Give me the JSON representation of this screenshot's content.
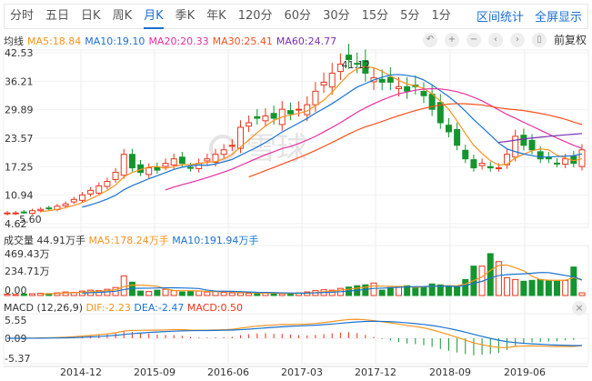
{
  "tabs": [
    "分时",
    "五日",
    "日K",
    "周K",
    "月K",
    "季K",
    "年K",
    "120分",
    "60分",
    "30分",
    "15分",
    "5分",
    "1分"
  ],
  "active_tab": "月K",
  "right_links": [
    "区间统计",
    "全屏显示"
  ],
  "ma": {
    "label": "均线",
    "items": [
      {
        "text": "MA5:18.84",
        "color": "#f7931e"
      },
      {
        "text": "MA10:19.10",
        "color": "#1a73d0"
      },
      {
        "text": "MA20:20.33",
        "color": "#e62ea1"
      },
      {
        "text": "MA30:25.41",
        "color": "#f4511e"
      },
      {
        "text": "MA60:24.77",
        "color": "#7b2fb0"
      }
    ]
  },
  "controls": [
    "↶",
    "+",
    "−",
    "‹",
    "›",
    "▯"
  ],
  "fuquan": "前复权",
  "price_axis": [
    "42.53",
    "36.21",
    "29.89",
    "23.57",
    "17.25",
    "10.94",
    "4.62"
  ],
  "max_label": "41.12",
  "min_label": "5.60",
  "watermark": "雪球",
  "volume": {
    "title": "成交量 44.91万手",
    "ma5": "MA5:178.24万手",
    "ma10": "MA10:191.94万手",
    "axis": [
      "469.43万",
      "234.71万",
      "0.00"
    ]
  },
  "macd": {
    "title": "MACD (12,26,9)",
    "dif": "DIF:-2.23",
    "dea": "DEA:-2.47",
    "macd": "MACD:0.50",
    "axis": [
      "5.55",
      "0.09",
      "-5.37"
    ],
    "close": "×"
  },
  "x_axis": [
    "2014-12",
    "2015-09",
    "2016-06",
    "2017-03",
    "2017-12",
    "2018-09",
    "2019-06"
  ],
  "colors": {
    "up": "#e8341c",
    "down": "#14952f"
  },
  "chart_data": {
    "type": "candlestick",
    "start": "2014-03",
    "period": "month",
    "ylim": [
      4.62,
      42.53
    ],
    "close": [
      7,
      7,
      7.2,
      7.5,
      7.8,
      8,
      8.5,
      9,
      10,
      11,
      12,
      13,
      14,
      16,
      20,
      17,
      16,
      17,
      16.5,
      18,
      19,
      18,
      17,
      18,
      19,
      20,
      21,
      22,
      26,
      27,
      28,
      28.5,
      28,
      30,
      29,
      30,
      31,
      34,
      36,
      38,
      40,
      41,
      40,
      38,
      37,
      36,
      36,
      35,
      34,
      35,
      33,
      30,
      27,
      25,
      22,
      19,
      17,
      18,
      17,
      17,
      20,
      24,
      22,
      21,
      19,
      19,
      18,
      19,
      18,
      21
    ],
    "volume": [
      15,
      12,
      18,
      20,
      25,
      22,
      30,
      40,
      35,
      50,
      60,
      55,
      70,
      90,
      220,
      150,
      50,
      45,
      60,
      70,
      55,
      40,
      45,
      50,
      40,
      45,
      35,
      30,
      30,
      25,
      20,
      30,
      25,
      20,
      25,
      30,
      40,
      55,
      65,
      60,
      80,
      95,
      110,
      120,
      140,
      60,
      90,
      100,
      110,
      95,
      90,
      130,
      120,
      110,
      100,
      180,
      330,
      330,
      470,
      380,
      200,
      180,
      160,
      170,
      180,
      170,
      170,
      170,
      320,
      30
    ]
  }
}
